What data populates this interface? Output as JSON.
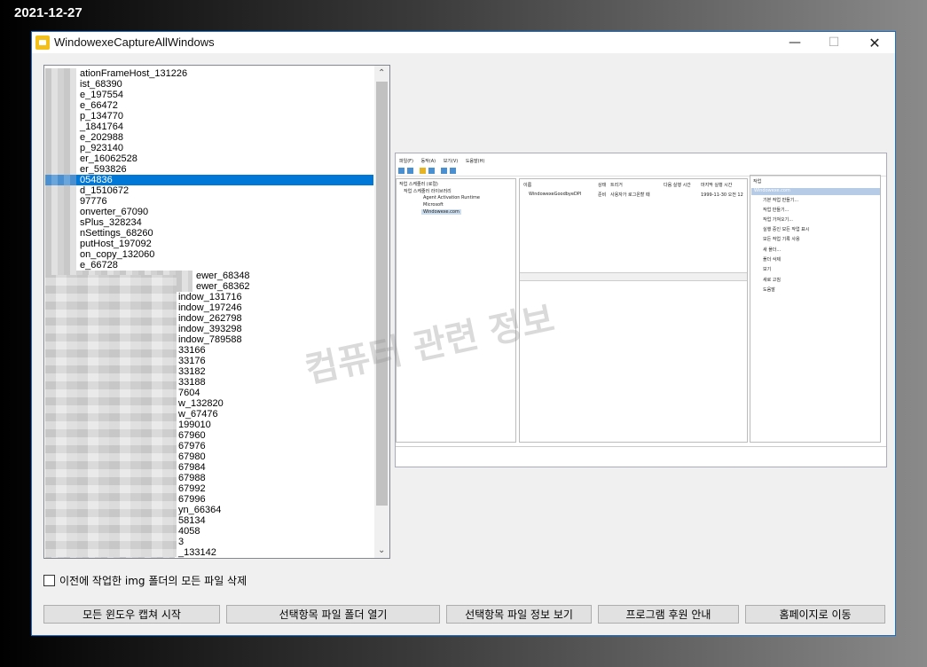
{
  "date": "2021-12-27",
  "window": {
    "title": "WindowexeCaptureAllWindows"
  },
  "list": {
    "items": [
      "ationFrameHost_131226",
      "ist_68390",
      "e_197554",
      "e_66472",
      "p_134770",
      "_1841764",
      "e_202988",
      "p_923140",
      "er_16062528",
      "er_593826",
      "054836",
      "d_1510672",
      "97776",
      "onverter_67090",
      "sPlus_328234",
      "nSettings_68260",
      "putHost_197092",
      "on_copy_132060",
      "e_66728",
      "ewer_68348",
      "ewer_68362",
      "indow_131716",
      "indow_197246",
      "indow_262798",
      "indow_393298",
      "indow_789588",
      "33166",
      "33176",
      "33182",
      "33188",
      "7604",
      "w_132820",
      "w_67476",
      "199010",
      "67960",
      "67976",
      "67980",
      "67984",
      "67988",
      "67992",
      "67996",
      "yn_66364",
      "58134",
      "4058",
      "3",
      "_133142"
    ],
    "selected_index": 10
  },
  "preview": {
    "menu": [
      "파일(F)",
      "동작(A)",
      "보기(V)",
      "도움말(H)"
    ],
    "tree": [
      "작업 스케줄러 (로컬)",
      "작업 스케줄러 라이브러리",
      "Agent Activation Runtime",
      "Microsoft",
      "Windowexe.com"
    ],
    "columns": [
      "이름",
      "상태",
      "트리거",
      "다음 실행 시간",
      "마지막 실행 시간"
    ],
    "task_row": [
      "WindowexeGoodbyeDPI",
      "준비",
      "사용자가 로그온할 때",
      "1999-11-30 오전 12"
    ],
    "actions_header": "작업",
    "actions_selected": "Windowexe.com",
    "actions": [
      "기본 작업 만들기...",
      "작업 만들기...",
      "작업 가져오기...",
      "실행 중인 모든 작업 표시",
      "모든 작업 기록 사용",
      "새 폴더...",
      "폴더 삭제",
      "보기",
      "새로 고침",
      "도움말"
    ],
    "watermark": "컴퓨터 관련 정보"
  },
  "checkbox": {
    "label": "이전에 작업한 img 폴더의 모든 파일 삭제",
    "checked": false
  },
  "buttons": [
    "모든 윈도우 캡쳐 시작",
    "선택항목 파일 폴더 열기",
    "선택항목 파일 정보 보기",
    "프로그램 후원 안내",
    "홈페이지로 이동"
  ]
}
